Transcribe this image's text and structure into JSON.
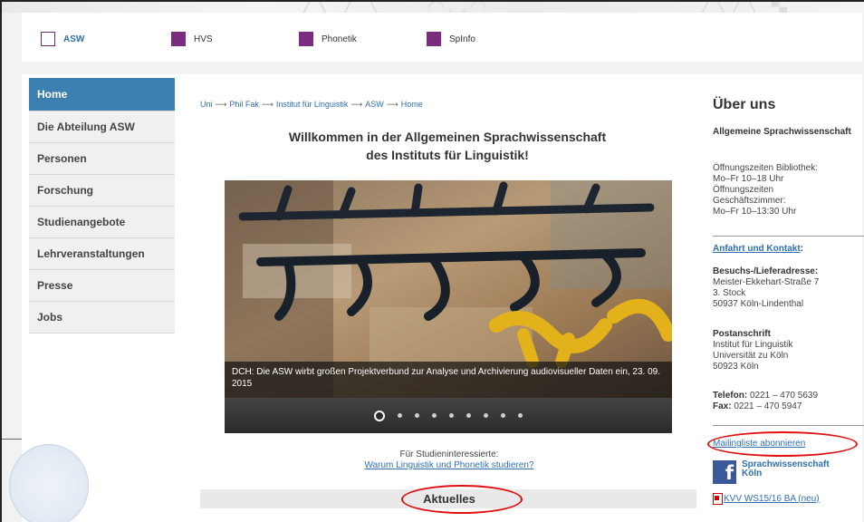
{
  "top_nav": {
    "items": [
      {
        "label": "ASW"
      },
      {
        "label": "HVS"
      },
      {
        "label": "Phonetik"
      },
      {
        "label": "SpInfo"
      }
    ]
  },
  "sidebar": {
    "items": [
      {
        "label": "Home"
      },
      {
        "label": "Die Abteilung ASW"
      },
      {
        "label": "Personen"
      },
      {
        "label": "Forschung"
      },
      {
        "label": "Studienangebote"
      },
      {
        "label": "Lehrveranstaltungen"
      },
      {
        "label": "Presse"
      },
      {
        "label": "Jobs"
      }
    ]
  },
  "breadcrumb": {
    "items": [
      "Uni",
      "Phil Fak",
      "Institut für Linguistik",
      "ASW",
      "Home"
    ],
    "separator": "⟶"
  },
  "main": {
    "welcome_line1": "Willkommen in der Allgemeinen Sprachwissenschaft",
    "welcome_line2": "des Instituts für Linguistik!",
    "slider_caption": "DCH: Die ASW wirbt großen Projektverbund zur Analyse und Archivierung audiovisueller Daten ein, 23. 09. 2015",
    "interest_label": "Für Studieninteressierte:",
    "interest_link": "Warum Linguistik und Phonetik studieren?",
    "section_heading": "Aktuelles"
  },
  "right": {
    "heading": "Über uns",
    "org_name": "Allgemeine Sprachwissenschaft",
    "hours_lines": [
      "Öffnungszeiten Bibliothek:",
      "Mo–Fr 10–18 Uhr",
      "Öffnungszeiten",
      "Geschäftszimmer:",
      "Mo–Fr 10–13:30 Uhr"
    ],
    "contact_link": "Anfahrt und Kontakt",
    "visit_title": "Besuchs-/Lieferadresse:",
    "visit_lines": [
      "Meister-Ekkehart-Straße 7",
      "3. Stock",
      "50937 Köln-Lindenthal"
    ],
    "post_title": "Postanschrift",
    "post_lines": [
      "Institut für Linguistik",
      "Universität zu Köln",
      "50923 Köln"
    ],
    "phone_label": "Telefon:",
    "phone_value": "0221 – 470 5639",
    "fax_label": "Fax:",
    "fax_value": "0221 – 470 5947",
    "mailing_link": "Mailingliste abonnieren",
    "facebook_line1": "Sprachwissenschaft",
    "facebook_line2": "Köln",
    "facebook_icon_letter": "f",
    "kvv_link": "KVV WS15/16 BA (neu)"
  },
  "colors": {
    "accent_blue": "#3c7fb1",
    "nav_purple": "#7a2c7e",
    "highlight_red": "#e01010"
  }
}
